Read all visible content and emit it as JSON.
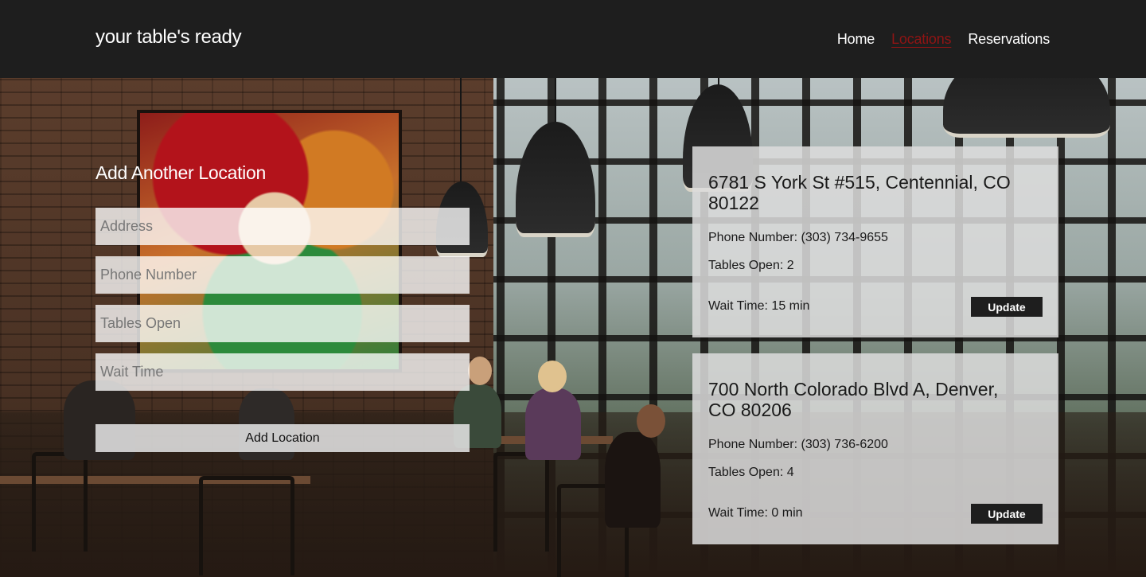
{
  "header": {
    "brand": "your table's ready",
    "nav": [
      "Home",
      "Locations",
      "Reservations"
    ],
    "active_nav": "Locations",
    "active_color": "#8f1414"
  },
  "form": {
    "title": "Add Another Location",
    "fields": {
      "address": {
        "placeholder": "Address",
        "value": ""
      },
      "phone": {
        "placeholder": "Phone Number",
        "value": ""
      },
      "tables": {
        "placeholder": "Tables Open",
        "value": ""
      },
      "wait": {
        "placeholder": "Wait Time",
        "value": ""
      }
    },
    "submit_label": "Add Location"
  },
  "locations": [
    {
      "address": "6781 S York St #515, Centennial, CO 80122",
      "phone": "Phone Number: (303) 734-9655",
      "tables": "Tables Open: 2",
      "wait": "Wait Time: 15 min",
      "button": "Update"
    },
    {
      "address": "700 North Colorado Blvd A, Denver, CO 80206",
      "phone": "Phone Number: (303) 736-6200",
      "tables": "Tables Open: 4",
      "wait": "Wait Time: 0 min",
      "button": "Update"
    }
  ]
}
